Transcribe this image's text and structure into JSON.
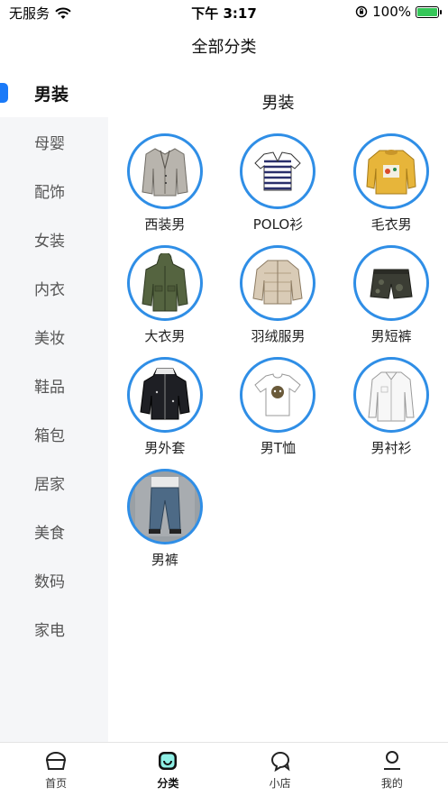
{
  "status_bar": {
    "carrier": "无服务",
    "time": "下午 3:17",
    "battery": "100%",
    "battery_level": 1.0
  },
  "nav": {
    "title": "全部分类"
  },
  "sidebar": {
    "items": [
      {
        "label": "男装",
        "active": true
      },
      {
        "label": "母婴"
      },
      {
        "label": "配饰"
      },
      {
        "label": "女装"
      },
      {
        "label": "内衣"
      },
      {
        "label": "美妆"
      },
      {
        "label": "鞋品"
      },
      {
        "label": "箱包"
      },
      {
        "label": "居家"
      },
      {
        "label": "美食"
      },
      {
        "label": "数码"
      },
      {
        "label": "家电"
      }
    ]
  },
  "main": {
    "section_title": "男装",
    "categories": [
      {
        "label": "西装男",
        "icon": "blazer-icon"
      },
      {
        "label": "POLO衫",
        "icon": "polo-shirt-icon"
      },
      {
        "label": "毛衣男",
        "icon": "sweater-icon"
      },
      {
        "label": "大衣男",
        "icon": "coat-icon"
      },
      {
        "label": "羽绒服男",
        "icon": "down-jacket-icon"
      },
      {
        "label": "男短裤",
        "icon": "shorts-icon"
      },
      {
        "label": "男外套",
        "icon": "jacket-icon"
      },
      {
        "label": "男T恤",
        "icon": "tshirt-icon"
      },
      {
        "label": "男衬衫",
        "icon": "dress-shirt-icon"
      },
      {
        "label": "男裤",
        "icon": "jeans-icon"
      }
    ]
  },
  "tab_bar": {
    "tabs": [
      {
        "label": "首页",
        "icon": "home-icon"
      },
      {
        "label": "分类",
        "icon": "category-icon",
        "active": true
      },
      {
        "label": "小店",
        "icon": "shop-chat-icon"
      },
      {
        "label": "我的",
        "icon": "profile-icon"
      }
    ]
  },
  "colors": {
    "accent": "#1a7af8",
    "ring": "#2f8ee6",
    "sidebar_bg": "#f5f6f8"
  }
}
